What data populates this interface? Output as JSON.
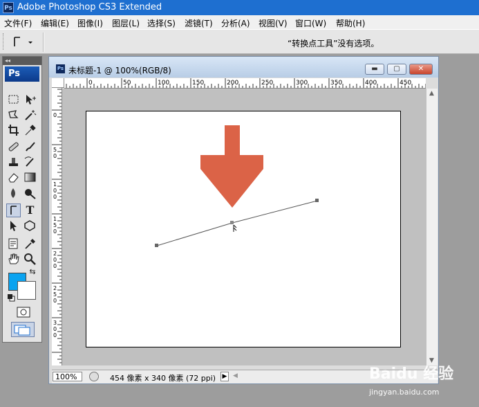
{
  "app": {
    "title": "Adobe Photoshop CS3 Extended",
    "logo": "Ps"
  },
  "menu": [
    "文件(F)",
    "编辑(E)",
    "图像(I)",
    "图层(L)",
    "选择(S)",
    "滤镜(T)",
    "分析(A)",
    "视图(V)",
    "窗口(W)",
    "帮助(H)"
  ],
  "options_bar": {
    "message": "“转换点工具”没有选项。"
  },
  "toolbox": {
    "logo": "Ps",
    "foreground_color": "#0aa3f0",
    "background_color": "#ffffff",
    "active_tool": "convert-point-tool"
  },
  "document": {
    "title": "未标题-1 @ 100%(RGB/8)",
    "icon": "Ps",
    "zoom": "100%",
    "info": "454 像素 x 340 像素 (72 ppi)",
    "ruler_h_labels": [
      "0",
      "50",
      "100",
      "150",
      "200",
      "250",
      "300",
      "350",
      "400",
      "450"
    ],
    "ruler_v_labels": [
      "0",
      "5",
      "0",
      "1",
      "0",
      "0",
      "1",
      "5",
      "0",
      "2",
      "0",
      "0",
      "2",
      "5",
      "0",
      "3",
      "0",
      "0"
    ],
    "arrow_color": "#db6347"
  },
  "watermark": {
    "brand": "Baidu 经验",
    "url": "jingyan.baidu.com"
  }
}
